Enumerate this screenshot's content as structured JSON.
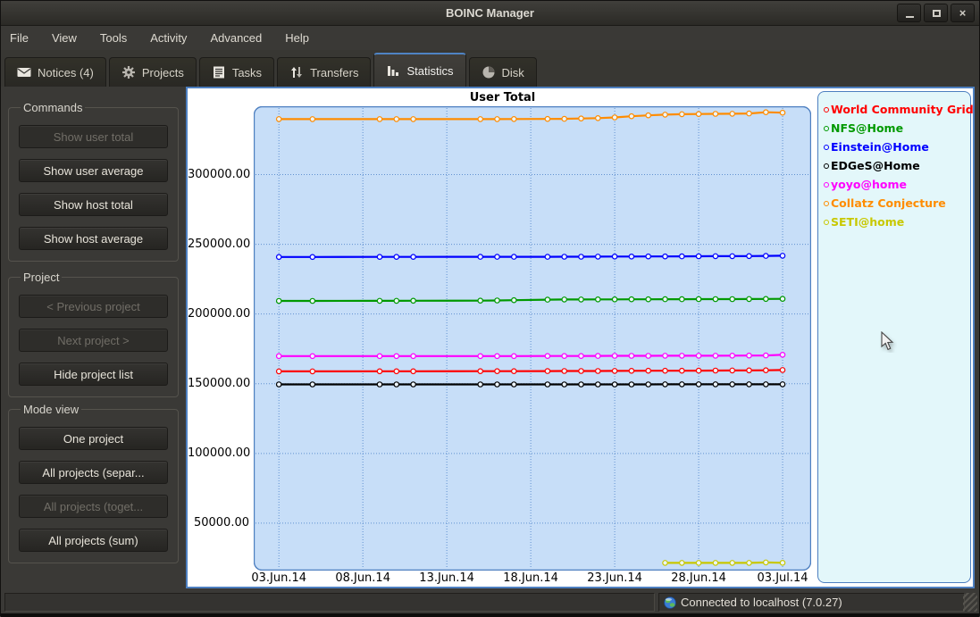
{
  "window": {
    "title": "BOINC Manager"
  },
  "menu": {
    "items": [
      "File",
      "View",
      "Tools",
      "Activity",
      "Advanced",
      "Help"
    ]
  },
  "tabs": [
    {
      "label": "Notices (4)",
      "icon": "notices-envelope-icon",
      "selected": false
    },
    {
      "label": "Projects",
      "icon": "projects-gear-icon",
      "selected": false
    },
    {
      "label": "Tasks",
      "icon": "tasks-list-icon",
      "selected": false
    },
    {
      "label": "Transfers",
      "icon": "transfers-arrows-icon",
      "selected": false
    },
    {
      "label": "Statistics",
      "icon": "statistics-bars-icon",
      "selected": true
    },
    {
      "label": "Disk",
      "icon": "disk-pie-icon",
      "selected": false
    }
  ],
  "sidebar": {
    "groups": [
      {
        "title": "Commands",
        "buttons": [
          {
            "label": "Show user total",
            "enabled": false
          },
          {
            "label": "Show user average",
            "enabled": true
          },
          {
            "label": "Show host total",
            "enabled": true
          },
          {
            "label": "Show host average",
            "enabled": true
          }
        ]
      },
      {
        "title": "Project",
        "buttons": [
          {
            "label": "< Previous project",
            "enabled": false
          },
          {
            "label": "Next project >",
            "enabled": false
          },
          {
            "label": "Hide project list",
            "enabled": true
          }
        ]
      },
      {
        "title": "Mode view",
        "buttons": [
          {
            "label": "One project",
            "enabled": true
          },
          {
            "label": "All projects (separ...",
            "enabled": true
          },
          {
            "label": "All projects (toget...",
            "enabled": false
          },
          {
            "label": "All projects (sum)",
            "enabled": true
          }
        ]
      }
    ]
  },
  "chart_data": {
    "type": "line",
    "title": "User Total",
    "xlabel": "",
    "ylabel": "",
    "grid": true,
    "legend_position": "right",
    "x_tick_labels": [
      "03.Jun.14",
      "08.Jun.14",
      "13.Jun.14",
      "18.Jun.14",
      "23.Jun.14",
      "28.Jun.14",
      "03.Jul.14"
    ],
    "x_tick_days": [
      1,
      6,
      11,
      16,
      21,
      26,
      31
    ],
    "x_day_zero": "02.Jun.14",
    "xlim_days": [
      -0.5,
      32.7
    ],
    "y_ticks": [
      50000,
      100000,
      150000,
      200000,
      250000,
      300000
    ],
    "y_tick_labels": [
      "50000.00",
      "100000.00",
      "150000.00",
      "200000.00",
      "250000.00",
      "300000.00"
    ],
    "ylim": [
      16000,
      349000
    ],
    "plot_bg": "#c7def8",
    "grid_color": "#5588cc",
    "border_color": "#4d7fc0",
    "legend_bg": "#e3f7fa",
    "series": [
      {
        "name": "World Community Grid",
        "color": "#ff0000",
        "points": [
          [
            1,
            158900
          ],
          [
            3,
            158900
          ],
          [
            7,
            158950
          ],
          [
            8,
            158950
          ],
          [
            9,
            158950
          ],
          [
            13,
            159000
          ],
          [
            14,
            159000
          ],
          [
            15,
            159000
          ],
          [
            17,
            159050
          ],
          [
            18,
            159100
          ],
          [
            19,
            159100
          ],
          [
            20,
            159150
          ],
          [
            21,
            159200
          ],
          [
            22,
            159250
          ],
          [
            23,
            159300
          ],
          [
            24,
            159300
          ],
          [
            25,
            159350
          ],
          [
            26,
            159400
          ],
          [
            27,
            159450
          ],
          [
            28,
            159500
          ],
          [
            29,
            159550
          ],
          [
            30,
            159650
          ],
          [
            31,
            159800
          ]
        ]
      },
      {
        "name": "NFS@Home",
        "color": "#009900",
        "points": [
          [
            1,
            209400
          ],
          [
            3,
            209400
          ],
          [
            7,
            209450
          ],
          [
            8,
            209450
          ],
          [
            9,
            209500
          ],
          [
            13,
            209600
          ],
          [
            14,
            209700
          ],
          [
            15,
            209900
          ],
          [
            17,
            210300
          ],
          [
            18,
            210400
          ],
          [
            19,
            210450
          ],
          [
            20,
            210500
          ],
          [
            21,
            210500
          ],
          [
            22,
            210550
          ],
          [
            23,
            210550
          ],
          [
            24,
            210600
          ],
          [
            25,
            210600
          ],
          [
            26,
            210650
          ],
          [
            27,
            210650
          ],
          [
            28,
            210700
          ],
          [
            29,
            210750
          ],
          [
            30,
            210800
          ],
          [
            31,
            210900
          ]
        ]
      },
      {
        "name": "Einstein@Home",
        "color": "#0000ff",
        "points": [
          [
            1,
            240900
          ],
          [
            3,
            240900
          ],
          [
            7,
            240950
          ],
          [
            8,
            240950
          ],
          [
            9,
            240950
          ],
          [
            13,
            241000
          ],
          [
            14,
            241000
          ],
          [
            15,
            241000
          ],
          [
            17,
            241050
          ],
          [
            18,
            241100
          ],
          [
            19,
            241100
          ],
          [
            20,
            241150
          ],
          [
            21,
            241200
          ],
          [
            22,
            241250
          ],
          [
            23,
            241300
          ],
          [
            24,
            241300
          ],
          [
            25,
            241350
          ],
          [
            26,
            241400
          ],
          [
            27,
            241450
          ],
          [
            28,
            241500
          ],
          [
            29,
            241550
          ],
          [
            30,
            241650
          ],
          [
            31,
            241800
          ]
        ]
      },
      {
        "name": "EDGeS@Home",
        "color": "#000000",
        "points": [
          [
            1,
            149500
          ],
          [
            3,
            149500
          ],
          [
            7,
            149500
          ],
          [
            8,
            149500
          ],
          [
            9,
            149500
          ],
          [
            13,
            149500
          ],
          [
            14,
            149500
          ],
          [
            15,
            149500
          ],
          [
            17,
            149500
          ],
          [
            18,
            149500
          ],
          [
            19,
            149520
          ],
          [
            20,
            149530
          ],
          [
            21,
            149540
          ],
          [
            22,
            149550
          ],
          [
            23,
            149550
          ],
          [
            24,
            149560
          ],
          [
            25,
            149560
          ],
          [
            26,
            149570
          ],
          [
            27,
            149580
          ],
          [
            28,
            149580
          ],
          [
            29,
            149590
          ],
          [
            30,
            149600
          ],
          [
            31,
            149600
          ]
        ]
      },
      {
        "name": "yoyo@home",
        "color": "#ff00ff",
        "points": [
          [
            1,
            169800
          ],
          [
            3,
            169800
          ],
          [
            7,
            169800
          ],
          [
            8,
            169800
          ],
          [
            9,
            169800
          ],
          [
            13,
            169850
          ],
          [
            14,
            169850
          ],
          [
            15,
            169850
          ],
          [
            17,
            169900
          ],
          [
            18,
            169900
          ],
          [
            19,
            169900
          ],
          [
            20,
            169950
          ],
          [
            21,
            170000
          ],
          [
            22,
            170000
          ],
          [
            23,
            170000
          ],
          [
            24,
            170050
          ],
          [
            25,
            170050
          ],
          [
            26,
            170100
          ],
          [
            27,
            170100
          ],
          [
            28,
            170150
          ],
          [
            29,
            170200
          ],
          [
            30,
            170300
          ],
          [
            31,
            170800
          ]
        ]
      },
      {
        "name": "Collatz Conjecture",
        "color": "#ff8c00",
        "points": [
          [
            1,
            339800
          ],
          [
            3,
            339800
          ],
          [
            7,
            339800
          ],
          [
            8,
            339800
          ],
          [
            9,
            339800
          ],
          [
            13,
            339800
          ],
          [
            14,
            339800
          ],
          [
            15,
            339850
          ],
          [
            17,
            339900
          ],
          [
            18,
            340000
          ],
          [
            19,
            340200
          ],
          [
            20,
            340500
          ],
          [
            21,
            341000
          ],
          [
            22,
            341800
          ],
          [
            23,
            342500
          ],
          [
            24,
            343000
          ],
          [
            25,
            343300
          ],
          [
            26,
            343450
          ],
          [
            27,
            343550
          ],
          [
            28,
            343650
          ],
          [
            29,
            343800
          ],
          [
            30,
            344700
          ],
          [
            31,
            344400
          ]
        ]
      },
      {
        "name": "SETI@home",
        "color": "#c8c800",
        "points": [
          [
            24,
            21500
          ],
          [
            25,
            21500
          ],
          [
            26,
            21500
          ],
          [
            27,
            21500
          ],
          [
            28,
            21500
          ],
          [
            29,
            21500
          ],
          [
            30,
            21800
          ],
          [
            31,
            21600
          ]
        ]
      }
    ]
  },
  "statusbar": {
    "connection_text": "Connected to localhost (7.0.27)"
  }
}
